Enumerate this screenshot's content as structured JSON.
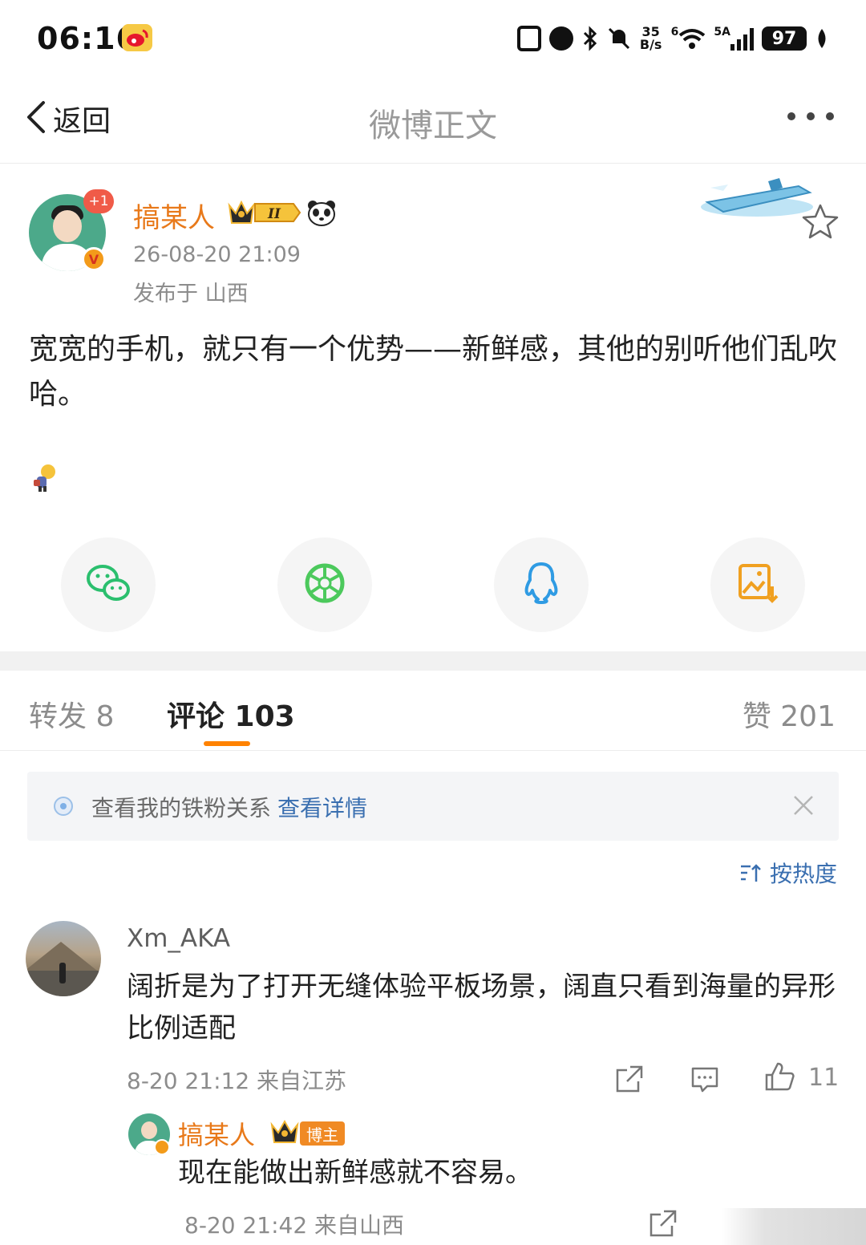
{
  "status_bar": {
    "time": "06:16",
    "net_speed_top": "35",
    "net_speed_bottom": "B/s",
    "wifi_label": "6",
    "signal_label": "5A",
    "battery": "97"
  },
  "nav": {
    "back_label": "返回",
    "title": "微博正文",
    "more_icon": "more-dots-icon"
  },
  "author": {
    "name": "搞某人",
    "plus_badge": "+1",
    "verified_mark": "V",
    "crown_level": "II",
    "time": "26-08-20 21:09",
    "location": "发布于 山西"
  },
  "post": {
    "text": "宽宽的手机，就只有一个优势——新鲜感，其他的别听他们乱吹哈。"
  },
  "share_buttons": [
    {
      "name": "wechat",
      "icon": "wechat-icon",
      "color": "#2bbf6e"
    },
    {
      "name": "moments",
      "icon": "moments-icon",
      "color": "#4cc95c"
    },
    {
      "name": "qq",
      "icon": "qq-icon",
      "color": "#2f9be3"
    },
    {
      "name": "save-image",
      "icon": "image-download-icon",
      "color": "#f0a020"
    }
  ],
  "tabs": {
    "repost": "转发 8",
    "comment": "评论 103",
    "like": "赞 201"
  },
  "fan_banner": {
    "text": "查看我的铁粉关系",
    "link": "查看详情"
  },
  "sort": {
    "label": "按热度"
  },
  "comment": {
    "user": "Xm_AKA",
    "text": "阔折是为了打开无缝体验平板场景，阔直只看到海量的异形比例适配",
    "meta": "8-20 21:12 来自江苏",
    "like_count": "11"
  },
  "reply": {
    "user": "搞某人",
    "badge": "博主",
    "text": "现在能做出新鲜感就不容易。",
    "meta": "8-20 21:42 来自山西"
  },
  "colors": {
    "accent": "#ff8200",
    "author_name": "#e8791a",
    "link": "#3a6fb0"
  }
}
